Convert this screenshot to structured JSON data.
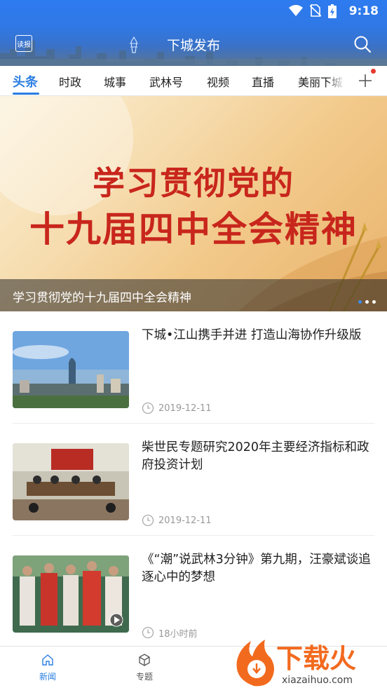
{
  "status_bar": {
    "time": "9:18"
  },
  "header": {
    "title": "下城发布",
    "read_button": "读报"
  },
  "tabs": [
    {
      "label": "头条",
      "active": true
    },
    {
      "label": "时政",
      "active": false
    },
    {
      "label": "城事",
      "active": false
    },
    {
      "label": "武林号",
      "active": false
    },
    {
      "label": "视频",
      "active": false
    },
    {
      "label": "直播",
      "active": false
    },
    {
      "label": "美丽下城",
      "active": false
    }
  ],
  "banner": {
    "line1": "学习贯彻党的",
    "line2": "十九届四中全会精神",
    "caption": "学习贯彻党的十九届四中全会精神"
  },
  "news": [
    {
      "title": "下城•江山携手并进 打造山海协作升级版",
      "date": "2019-12-11"
    },
    {
      "title": "柴世民专题研究2020年主要经济指标和政府投资计划",
      "date": "2019-12-11"
    },
    {
      "title": "《“潮”说武林3分钟》第九期，汪豪斌谈追逐心中的梦想",
      "date": "18小时前"
    }
  ],
  "bottom_nav": [
    {
      "label": "新闻",
      "active": true
    },
    {
      "label": "专题",
      "active": false
    }
  ],
  "watermark": {
    "text": "下载火",
    "url": "xiazaihuo.com"
  },
  "colors": {
    "accent": "#2a7de1",
    "banner_red": "#c8261c",
    "header_blue": "#2e7bf0"
  }
}
